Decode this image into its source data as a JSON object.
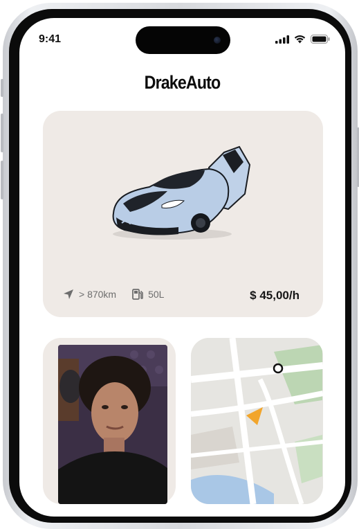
{
  "status_bar": {
    "time": "9:41"
  },
  "app": {
    "title": "DrakeAuto"
  },
  "car_card": {
    "range": "> 870km",
    "fuel": "50L",
    "price": "$ 45,00/h",
    "icons": {
      "range": "navigation-arrow-icon",
      "fuel": "fuel-pump-icon"
    }
  },
  "colors": {
    "card": "#efeae6",
    "accent": "#f2a52b",
    "car_body": "#b9cde6"
  }
}
